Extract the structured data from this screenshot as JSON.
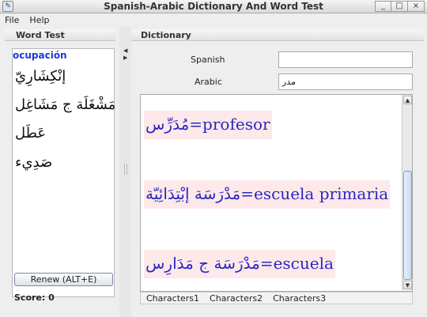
{
  "window": {
    "title": "Spanish-Arabic Dictionary And Word Test",
    "controls": {
      "minimize": "_",
      "maximize": "□",
      "close": "×"
    }
  },
  "menu": {
    "items": [
      "File",
      "Help"
    ]
  },
  "word_test": {
    "header": "Word Test",
    "current_word": "ocupación",
    "arabic_words": [
      "إنْكِشَارِيّ",
      "مَشْغَلَة ج مَشَاغِل",
      "عَطَل",
      "صَدِيء"
    ],
    "renew_button": "Renew (ALT+E)",
    "score": "Score: 0"
  },
  "dictionary": {
    "header": "Dictionary",
    "spanish_label": "Spanish",
    "spanish_value": "",
    "arabic_label": "Arabic",
    "arabic_value": "مدر",
    "entries": [
      {
        "ar": "مُدَرِّس",
        "es": "=profesor"
      },
      {
        "ar": "مَدْرَسَة إبْتِدَائِيّة",
        "es": "=escuela primaria"
      },
      {
        "ar": "مَدْرَسَة ج مَدَارِس",
        "es": "=escuela"
      }
    ],
    "tabs": [
      "Characters1",
      "Characters2",
      "Characters3"
    ]
  },
  "colors": {
    "entry_text": "#2a27c2",
    "entry_background": "#fde9ea",
    "current_word": "#1a3ad6"
  }
}
